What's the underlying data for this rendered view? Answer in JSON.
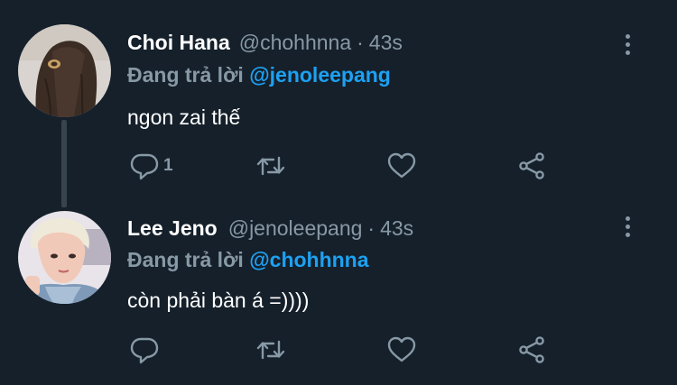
{
  "tweets": [
    {
      "name": "Choi Hana",
      "handle": "@chohhnna",
      "separator": "·",
      "time": "43s",
      "replying_prefix": "Đang trả lời",
      "replying_to": "@jenoleepang",
      "text": "ngon zai thế",
      "reply_count": "1",
      "avatar_icon": "profile-photo-woman-long-hair"
    },
    {
      "name": "Lee Jeno",
      "handle": "@jenoleepang",
      "separator": "·",
      "time": "43s",
      "replying_prefix": "Đang trả lời",
      "replying_to": "@chohhnna",
      "text": "còn phải bàn á =))))",
      "reply_count": "",
      "avatar_icon": "profile-photo-man-blonde"
    }
  ],
  "icons": {
    "reply": "reply-icon",
    "retweet": "retweet-icon",
    "like": "like-icon",
    "share": "share-icon",
    "more": "more-options-icon"
  },
  "colors": {
    "background": "#15202b",
    "text_primary": "#ffffff",
    "text_secondary": "#8899a6",
    "link": "#1da1f2",
    "thread_line": "#38444d"
  }
}
